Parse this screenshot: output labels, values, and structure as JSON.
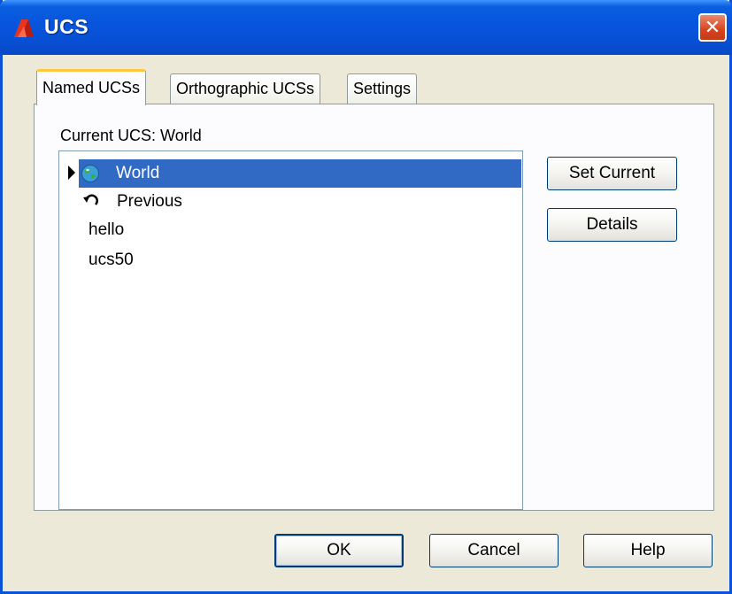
{
  "window": {
    "title": "UCS",
    "close_label": "✕"
  },
  "tabs": [
    {
      "label": "Named UCSs",
      "active": true
    },
    {
      "label": "Orthographic UCSs",
      "active": false
    },
    {
      "label": "Settings",
      "active": false
    }
  ],
  "named_ucs": {
    "current_label": "Current UCS:  World",
    "items": [
      {
        "label": "World",
        "icon": "globe-icon",
        "selected": true,
        "marker": "current-marker-icon"
      },
      {
        "label": "Previous",
        "icon": "undo-arrow-icon",
        "selected": false
      },
      {
        "label": "hello",
        "selected": false
      },
      {
        "label": "ucs50",
        "selected": false
      }
    ],
    "set_current_label": "Set Current",
    "details_label": "Details"
  },
  "footer": {
    "ok_label": "OK",
    "cancel_label": "Cancel",
    "help_label": "Help"
  },
  "colors": {
    "title_bar": "#0855dd",
    "selection": "#316ac5",
    "dialog_bg": "#ece9d8",
    "close_button": "#d8431f"
  }
}
